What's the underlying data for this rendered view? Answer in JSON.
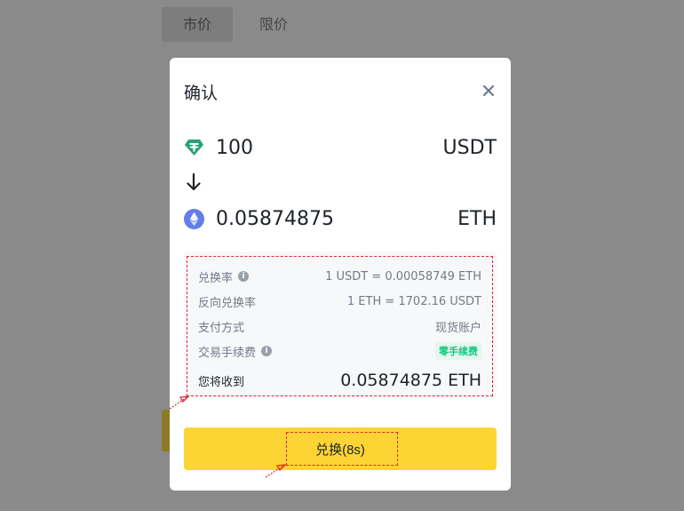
{
  "background": {
    "tabs": [
      "市价",
      "限价"
    ]
  },
  "modal": {
    "title": "确认",
    "from": {
      "amount": "100",
      "symbol": "USDT",
      "icon": "tether-icon"
    },
    "to": {
      "amount": "0.05874875",
      "symbol": "ETH",
      "icon": "ethereum-icon"
    },
    "details": {
      "rate_label": "兑换率",
      "rate_value": "1 USDT = 0.00058749 ETH",
      "reverse_label": "反向兑换率",
      "reverse_value": "1 ETH = 1702.16 USDT",
      "payment_label": "支付方式",
      "payment_value": "现货账户",
      "fee_label": "交易手续费",
      "fee_value": "零手续费",
      "receive_label": "您将收到",
      "receive_value": "0.05874875 ETH"
    },
    "confirm_label": "兑换(8s)"
  },
  "colors": {
    "accent_yellow": "#fcd535",
    "fee_green": "#0ecb81",
    "annotation_red": "#e0242b"
  }
}
